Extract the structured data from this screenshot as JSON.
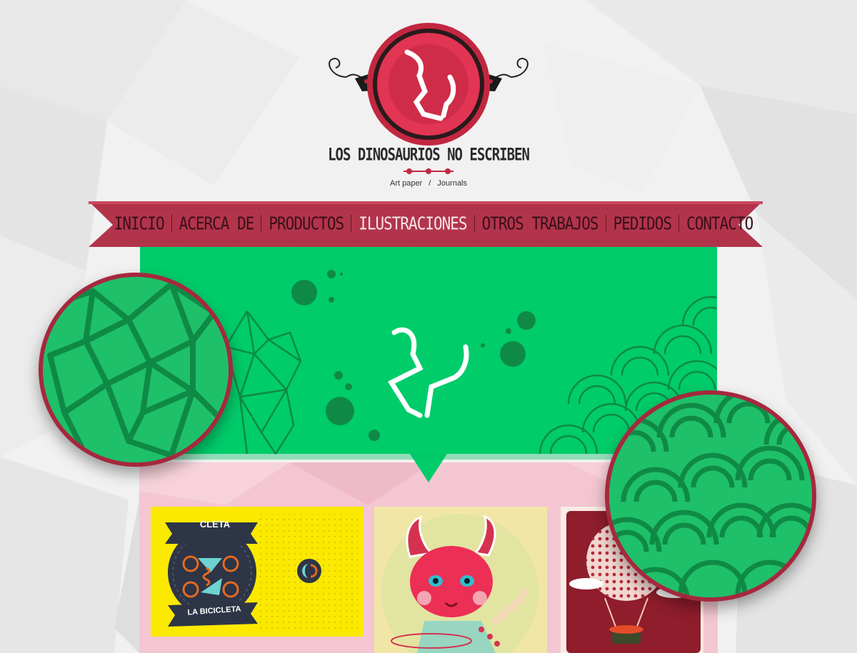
{
  "brand": {
    "name": "LOS DINOSAURIOS NO ESCRIBEN",
    "tagline_left": "Art paper",
    "tagline_sep": "/",
    "tagline_right": "Journals"
  },
  "nav": {
    "items": [
      {
        "label": "INICIO",
        "name": "nav-inicio"
      },
      {
        "label": "ACERCA DE",
        "name": "nav-acerca-de"
      },
      {
        "label": "PRODUCTOS",
        "name": "nav-productos"
      },
      {
        "label": "ILUSTRACIONES",
        "name": "nav-ilustraciones"
      },
      {
        "label": "OTROS TRABAJOS",
        "name": "nav-otros-trabajos"
      },
      {
        "label": "PEDIDOS",
        "name": "nav-pedidos"
      },
      {
        "label": "CONTACTO",
        "name": "nav-contacto"
      }
    ],
    "active_index": 3
  },
  "cards": [
    {
      "top_label": "CLETA",
      "bottom_label": "LA BICICLETA"
    },
    {},
    {}
  ],
  "colors": {
    "ribbon": "#b2344b",
    "hero_green": "#00cc6a",
    "pattern_green": "#0f8a46",
    "pink_panel": "#f3c6d1",
    "logo_red": "#c22741",
    "yellow_card": "#fbe900"
  },
  "icons": [
    "dinosaur-claw-icon",
    "bicycle-icon"
  ]
}
